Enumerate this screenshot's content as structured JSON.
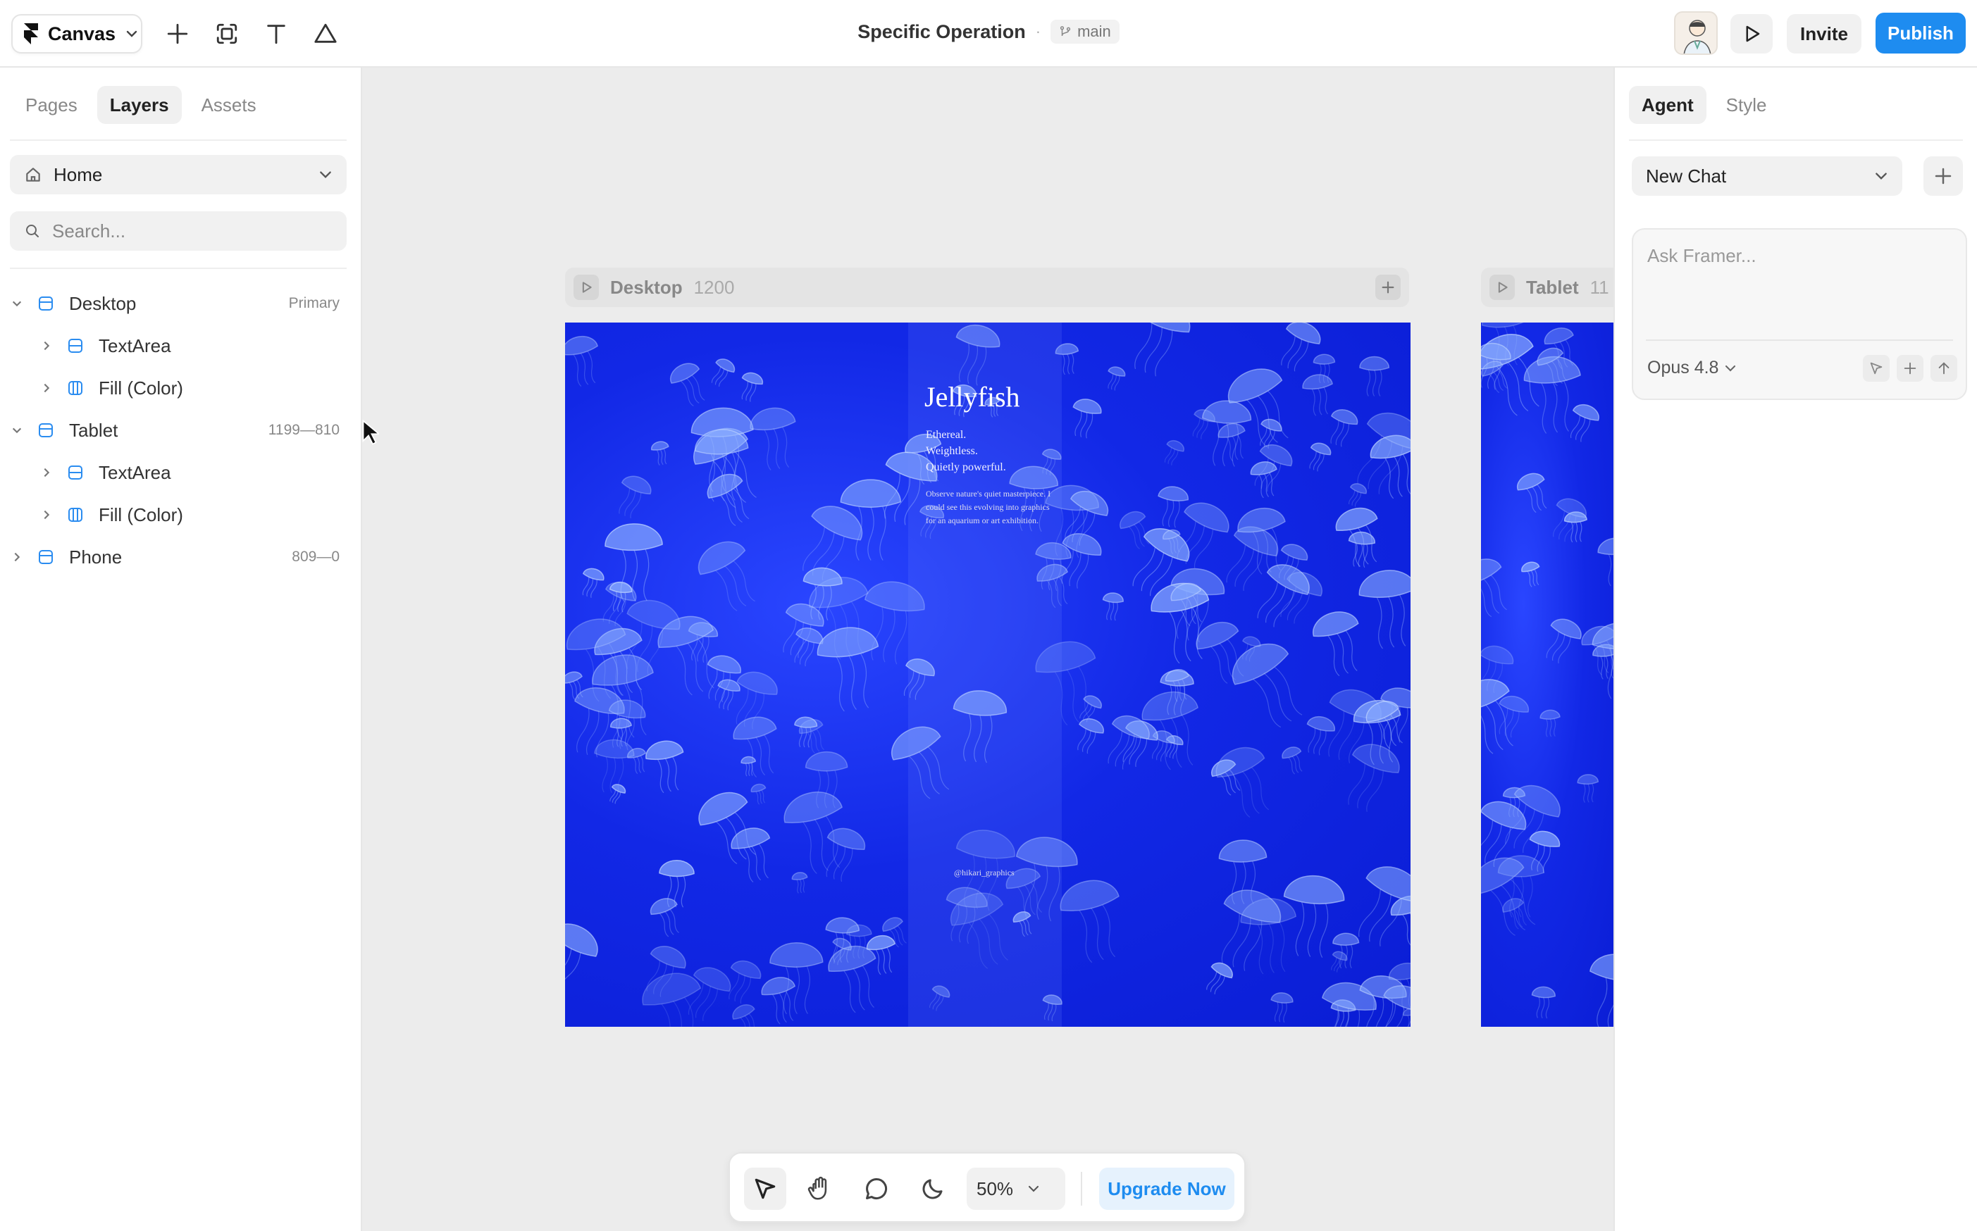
{
  "app": {
    "menu_label": "Canvas",
    "brand_color": "#1e8cf0"
  },
  "document": {
    "title": "Specific Operation",
    "separator": "·",
    "branch": "main"
  },
  "header": {
    "invite_label": "Invite",
    "publish_label": "Publish"
  },
  "left_panel": {
    "tabs": [
      {
        "label": "Pages",
        "active": false
      },
      {
        "label": "Layers",
        "active": true
      },
      {
        "label": "Assets",
        "active": false
      }
    ],
    "page_select": {
      "value": "Home",
      "icon": "home-icon"
    },
    "search": {
      "placeholder": "Search..."
    },
    "layers": [
      {
        "name": "Desktop",
        "meta": "Primary",
        "level": 0,
        "expanded": true,
        "icon": "frame-icon"
      },
      {
        "name": "TextArea",
        "meta": "",
        "level": 1,
        "expanded": false,
        "icon": "stack-icon"
      },
      {
        "name": "Fill (Color)",
        "meta": "",
        "level": 1,
        "expanded": false,
        "icon": "columns-icon"
      },
      {
        "name": "Tablet",
        "meta": "1199—810",
        "level": 0,
        "expanded": true,
        "icon": "frame-icon"
      },
      {
        "name": "TextArea",
        "meta": "",
        "level": 1,
        "expanded": false,
        "icon": "stack-icon"
      },
      {
        "name": "Fill (Color)",
        "meta": "",
        "level": 1,
        "expanded": false,
        "icon": "columns-icon"
      },
      {
        "name": "Phone",
        "meta": "809—0",
        "level": 0,
        "expanded": false,
        "icon": "frame-icon"
      }
    ]
  },
  "canvas": {
    "frames": [
      {
        "name": "Desktop",
        "width_label": "1200"
      },
      {
        "name": "Tablet",
        "width_label": "11"
      }
    ],
    "artwork": {
      "title": "Jellyfish",
      "lines": [
        "Ethereal.",
        "Weightless.",
        "Quietly powerful."
      ],
      "body": "Observe nature's quiet masterpiece. I could see this evolving into graphics for an aquarium or art exhibition.",
      "handle": "@hikari_graphics",
      "background_color": "#0a1dd4"
    }
  },
  "right_panel": {
    "tabs": [
      {
        "label": "Agent",
        "active": true
      },
      {
        "label": "Style",
        "active": false
      }
    ],
    "chat_select": "New Chat",
    "ask": {
      "placeholder": "Ask Framer...",
      "value": ""
    },
    "model": "Opus 4.8"
  },
  "bottom_toolbar": {
    "tools": [
      "pointer-icon",
      "hand-icon",
      "comment-icon",
      "moon-icon"
    ],
    "zoom": "50%",
    "upgrade_label": "Upgrade Now"
  }
}
